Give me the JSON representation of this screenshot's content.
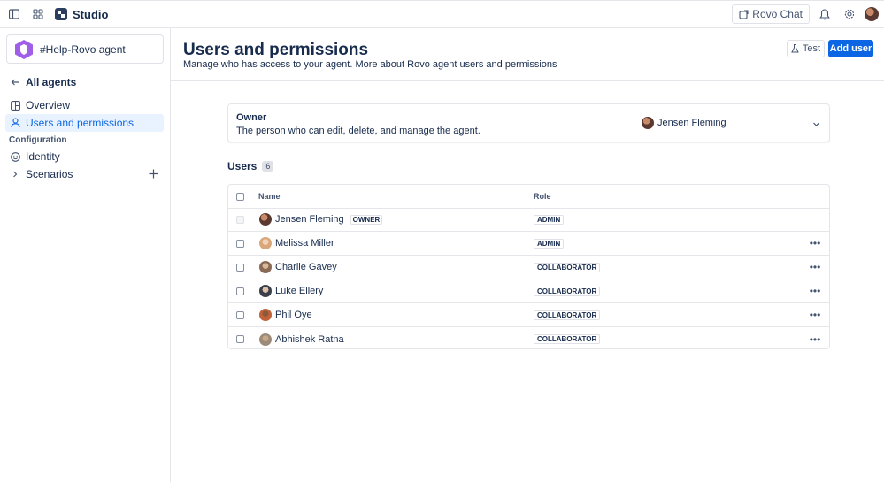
{
  "topbar": {
    "app_name": "Studio",
    "rovo_chat_label": "Rovo Chat"
  },
  "sidebar": {
    "agent_name": "#Help-Rovo agent",
    "back_label": "All agents",
    "items": [
      {
        "label": "Overview"
      },
      {
        "label": "Users and permissions"
      }
    ],
    "section_label": "Configuration",
    "config_items": [
      {
        "label": "Identity"
      },
      {
        "label": "Scenarios"
      }
    ]
  },
  "header": {
    "title": "Users and permissions",
    "subtitle": "Manage who has access to your agent. More about Rovo agent users and permissions",
    "test_label": "Test",
    "add_user_label": "Add user"
  },
  "owner": {
    "title": "Owner",
    "description": "The person who can edit, delete, and manage the agent.",
    "name": "Jensen Fleming"
  },
  "users": {
    "heading": "Users",
    "count": "6",
    "columns": {
      "name": "Name",
      "role": "Role"
    },
    "owner_badge": "OWNER",
    "rows": [
      {
        "name": "Jensen Fleming",
        "role": "ADMIN",
        "avatar_color": "#5a3a30"
      },
      {
        "name": "Melissa Miller",
        "role": "ADMIN",
        "avatar_color": "#d9a77a"
      },
      {
        "name": "Charlie Gavey",
        "role": "COLLABORATOR",
        "avatar_color": "#8a6a55"
      },
      {
        "name": "Luke Ellery",
        "role": "COLLABORATOR",
        "avatar_color": "#3b3f4a"
      },
      {
        "name": "Phil Oye",
        "role": "COLLABORATOR",
        "avatar_color": "#c0623a"
      },
      {
        "name": "Abhishek Ratna",
        "role": "COLLABORATOR",
        "avatar_color": "#9c8a7a"
      }
    ]
  },
  "colors": {
    "accent": "#0c66e4",
    "text": "#172b4d",
    "subtle": "#44546f",
    "border": "#e4e6ea",
    "agent_purple": "#9f5fe8"
  }
}
